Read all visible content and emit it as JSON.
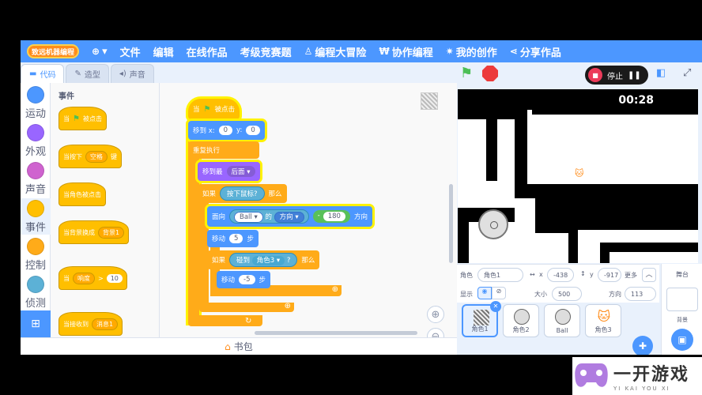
{
  "menubar": {
    "logo_text": "致远机器编程",
    "items": [
      {
        "icon": "globe-icon",
        "label": "▾"
      },
      {
        "label": "文件"
      },
      {
        "label": "编辑"
      },
      {
        "label": "在线作品"
      },
      {
        "label": "考级竞赛题"
      },
      {
        "icon": "person-icon",
        "label": "编程大冒险"
      },
      {
        "icon": "handshake-icon",
        "label": "协作编程"
      },
      {
        "icon": "lightbulb-icon",
        "label": "我的创作"
      },
      {
        "icon": "share-icon",
        "label": "分享作品"
      }
    ]
  },
  "tabs": [
    {
      "label": "代码",
      "active": true
    },
    {
      "label": "造型",
      "active": false
    },
    {
      "label": "声音",
      "active": false
    }
  ],
  "categories": [
    {
      "label": "运动",
      "color": "#4c97ff"
    },
    {
      "label": "外观",
      "color": "#9966ff"
    },
    {
      "label": "声音",
      "color": "#cf63cf"
    },
    {
      "label": "事件",
      "color": "#ffbf00"
    },
    {
      "label": "控制",
      "color": "#ffab19"
    },
    {
      "label": "侦测",
      "color": "#5cb1d6"
    }
  ],
  "palette": {
    "title": "事件",
    "blocks": [
      {
        "text": "当",
        "flag": true,
        "after": "被点击"
      },
      {
        "text": "当按下",
        "dropdown": "空格",
        "after": "键"
      },
      {
        "text": "当角色被点击"
      },
      {
        "text": "当背景换成",
        "dropdown": "背景1"
      },
      {
        "text": "当",
        "dropdown": "响度",
        "op": ">",
        "value": "10"
      },
      {
        "text": "当接收到",
        "dropdown": "消息1"
      }
    ]
  },
  "script": {
    "hat": {
      "text": "当",
      "after": "被点击"
    },
    "goto": {
      "label": "移到 x:",
      "x": "0",
      "ylabel": "y:",
      "y": "0"
    },
    "forever": "重复执行",
    "layer": {
      "label": "移到最",
      "value": "后面"
    },
    "if1": {
      "label": "如果",
      "cond": "按下鼠标?",
      "then": "那么"
    },
    "point": {
      "label": "面向",
      "target": "Ball",
      "of": "的",
      "prop": "方向",
      "minus": "-",
      "value": "180",
      "suffix": "方向"
    },
    "move1": {
      "label": "移动",
      "value": "5",
      "suffix": "步"
    },
    "if2": {
      "label": "如果",
      "cond_label": "碰到",
      "cond_target": "角色3",
      "cond_q": "?",
      "then": "那么"
    },
    "move2": {
      "label": "移动",
      "value": "-5",
      "suffix": "步"
    }
  },
  "stage": {
    "timer": "00:28",
    "stop_label": "停止"
  },
  "sprite_info": {
    "sprite_label": "角色",
    "sprite_name": "角色1",
    "x_label": "x",
    "x": "-438",
    "y_label": "y",
    "y": "-917",
    "more": "更多",
    "show_label": "显示",
    "size_label": "大小",
    "size": "500",
    "dir_label": "方向",
    "direction": "113"
  },
  "sprites": [
    {
      "name": "角色1",
      "selected": true
    },
    {
      "name": "角色2",
      "selected": false
    },
    {
      "name": "Ball",
      "selected": false
    },
    {
      "name": "角色3",
      "selected": false
    }
  ],
  "stage_pane": {
    "title": "舞台",
    "backdrop_label": "背景"
  },
  "backpack": "书包",
  "watermark": {
    "title": "一开游戏",
    "subtitle": "YI KAI YOU XI"
  }
}
